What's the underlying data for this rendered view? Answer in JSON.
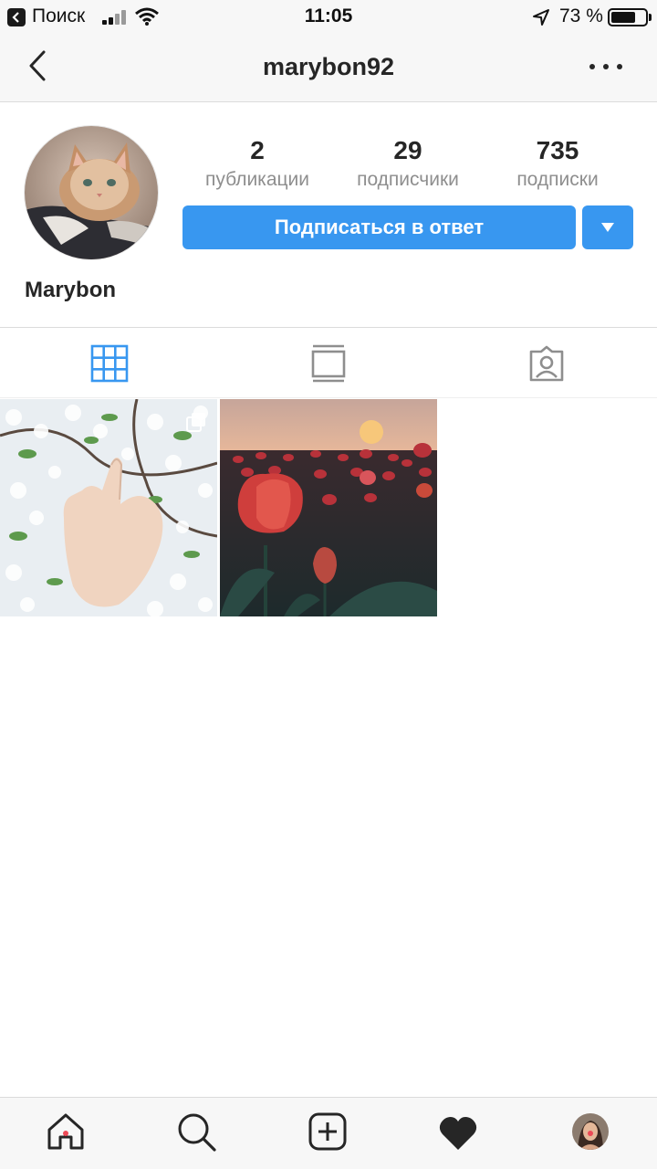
{
  "status_bar": {
    "carrier": "Поиск",
    "time": "11:05",
    "battery_percent": "73 %",
    "battery_level": 0.73,
    "icons": [
      "back-to-app-icon",
      "signal-icon",
      "wifi-icon",
      "location-arrow-icon",
      "battery-icon"
    ]
  },
  "header": {
    "username": "marybon92",
    "icons": [
      "chevron-left-icon",
      "more-dots-icon"
    ]
  },
  "profile": {
    "display_name": "Marybon",
    "stats": [
      {
        "value": "2",
        "label": "публикации"
      },
      {
        "value": "29",
        "label": "подписчики"
      },
      {
        "value": "735",
        "label": "подписки"
      }
    ],
    "follow_button_label": "Подписаться в ответ",
    "accent_color": "#3897f0"
  },
  "tabs": {
    "items": [
      "grid-icon",
      "feed-icon",
      "tagged-icon"
    ],
    "active": "grid-icon"
  },
  "posts": [
    {
      "subject": "hand among white blossoms",
      "multiple": true
    },
    {
      "subject": "red tulips at sunset",
      "multiple": false
    }
  ],
  "bottom_nav": {
    "items": [
      "home-icon",
      "search-icon",
      "add-post-icon",
      "activity-heart-icon",
      "profile-avatar"
    ],
    "notification_color": "#ed4956"
  }
}
